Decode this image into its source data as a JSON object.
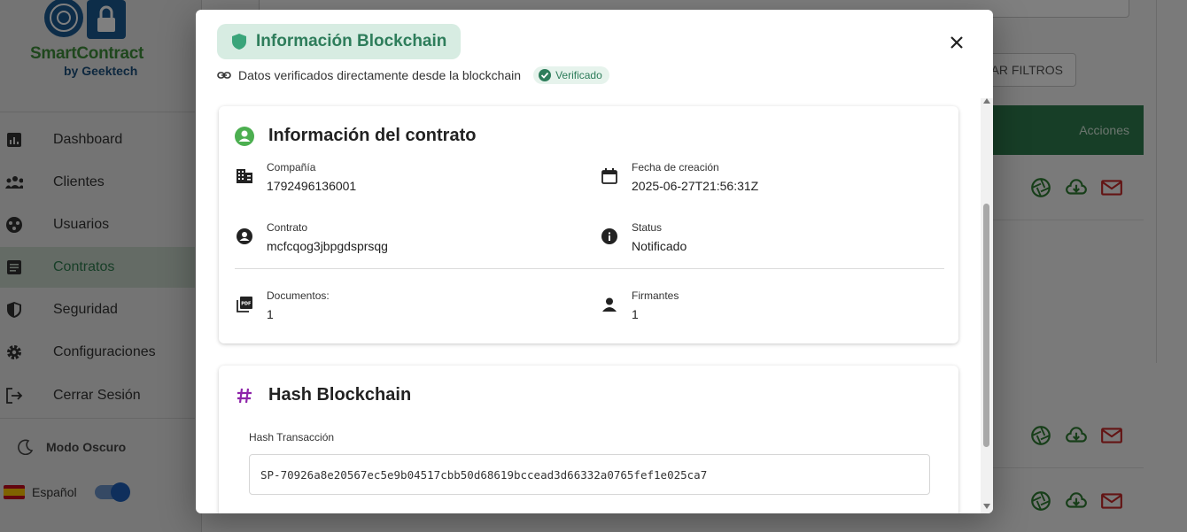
{
  "sidebar": {
    "brand_line1": "SmartContract",
    "brand_line2": "by Geektech",
    "items": [
      {
        "label": "Dashboard"
      },
      {
        "label": "Clientes"
      },
      {
        "label": "Usuarios"
      },
      {
        "label": "Contratos"
      },
      {
        "label": "Seguridad"
      },
      {
        "label": "Configuraciones"
      },
      {
        "label": "Cerrar Sesión"
      }
    ],
    "dark_mode_label": "Modo Oscuro",
    "language_label": "Español"
  },
  "background": {
    "filters_button": "AR FILTROS",
    "table_actions_header": "Acciones"
  },
  "modal": {
    "title": "Información Blockchain",
    "subtitle": "Datos verificados directamente desde la blockchain",
    "verified_badge": "Verificado",
    "contract_section": {
      "title": "Información del contrato",
      "company_label": "Compañía",
      "company_value": "1792496136001",
      "created_label": "Fecha de creación",
      "created_value": "2025-06-27T21:56:31Z",
      "contract_label": "Contrato",
      "contract_value": "mcfcqog3jbpgdsprsqg",
      "status_label": "Status",
      "status_value": "Notificado",
      "documents_label": "Documentos:",
      "documents_value": "1",
      "signers_label": "Firmantes",
      "signers_value": "1"
    },
    "hash_section": {
      "title": "Hash Blockchain",
      "tx_label": "Hash Transacción",
      "tx_value": "SP-70926a8e20567ec5e9b04517cbb50d68619bccead3d66332a0765fef1e025ca7"
    }
  },
  "colors": {
    "brand_green": "#2e7d4f",
    "accent_teal": "#2e7d5b",
    "hash_icon_purple": "#8e24aa"
  }
}
